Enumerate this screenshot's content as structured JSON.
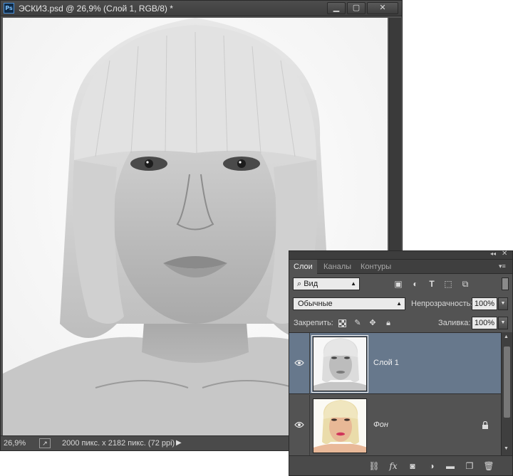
{
  "document": {
    "app_icon": "Ps",
    "title": "ЭСКИЗ.psd @ 26,9% (Слой 1, RGB/8) *",
    "controls": {
      "minimize": "minimize-icon",
      "maximize": "maximize-icon",
      "close": "close-icon"
    },
    "status": {
      "zoom": "26,9%",
      "info": "2000 пикс. x 2182 пикс. (72 ppi)"
    }
  },
  "layers_panel": {
    "tabs": [
      {
        "label": "Слои",
        "active": true
      },
      {
        "label": "Каналы",
        "active": false
      },
      {
        "label": "Контуры",
        "active": false
      }
    ],
    "filter": {
      "value": "Вид",
      "icons": [
        "image-filter-icon",
        "adjustment-filter-icon",
        "type-filter-icon",
        "shape-filter-icon",
        "smart-object-filter-icon"
      ]
    },
    "blend_mode": "Обычные",
    "opacity_label": "Непрозрачность:",
    "opacity_value": "100%",
    "lock_label": "Закрепить:",
    "fill_label": "Заливка:",
    "fill_value": "100%",
    "layers": [
      {
        "name": "Слой 1",
        "selected": true,
        "visible": true,
        "locked": false
      },
      {
        "name": "Фон",
        "selected": false,
        "visible": true,
        "locked": true
      }
    ],
    "bottom_icons": [
      "link-layers-icon",
      "fx-icon",
      "add-mask-icon",
      "adjustment-layer-icon",
      "new-group-icon",
      "new-layer-icon",
      "delete-layer-icon"
    ],
    "bottom_fx_label": "fx",
    "colors": {
      "selected_row": "#67788c",
      "panel_bg": "#535353"
    }
  }
}
